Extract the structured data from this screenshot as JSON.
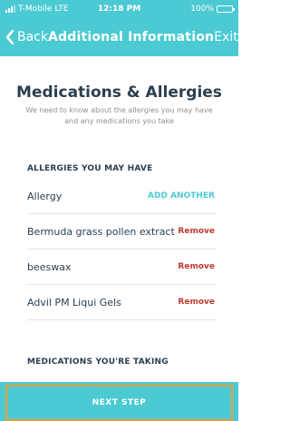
{
  "status_bar": {
    "carrier": "T-Mobile",
    "network": "LTE",
    "time": "12:18 PM",
    "battery": "100%"
  },
  "nav": {
    "back_label": "Back",
    "title": "Additional Information",
    "exit_label": "Exit"
  },
  "page": {
    "title": "Medications & Allergies",
    "subtitle": "We need to know about the allergies you may have and any medications you take"
  },
  "allergies": {
    "header": "ALLERGIES YOU MAY HAVE",
    "field_label": "Allergy",
    "add_label": "ADD ANOTHER",
    "items": [
      {
        "name": "Bermuda grass pollen extract",
        "action": "Remove"
      },
      {
        "name": "beeswax",
        "action": "Remove"
      },
      {
        "name": "Advil PM Liqui Gels",
        "action": "Remove"
      }
    ]
  },
  "medications": {
    "header": "MEDICATIONS YOU'RE TAKING"
  },
  "footer": {
    "next_label": "NEXT STEP"
  },
  "colors": {
    "accent": "#4ccad3",
    "remove": "#c0392b",
    "highlight_border": "#f29b39",
    "text_dark": "#2c3e50"
  }
}
